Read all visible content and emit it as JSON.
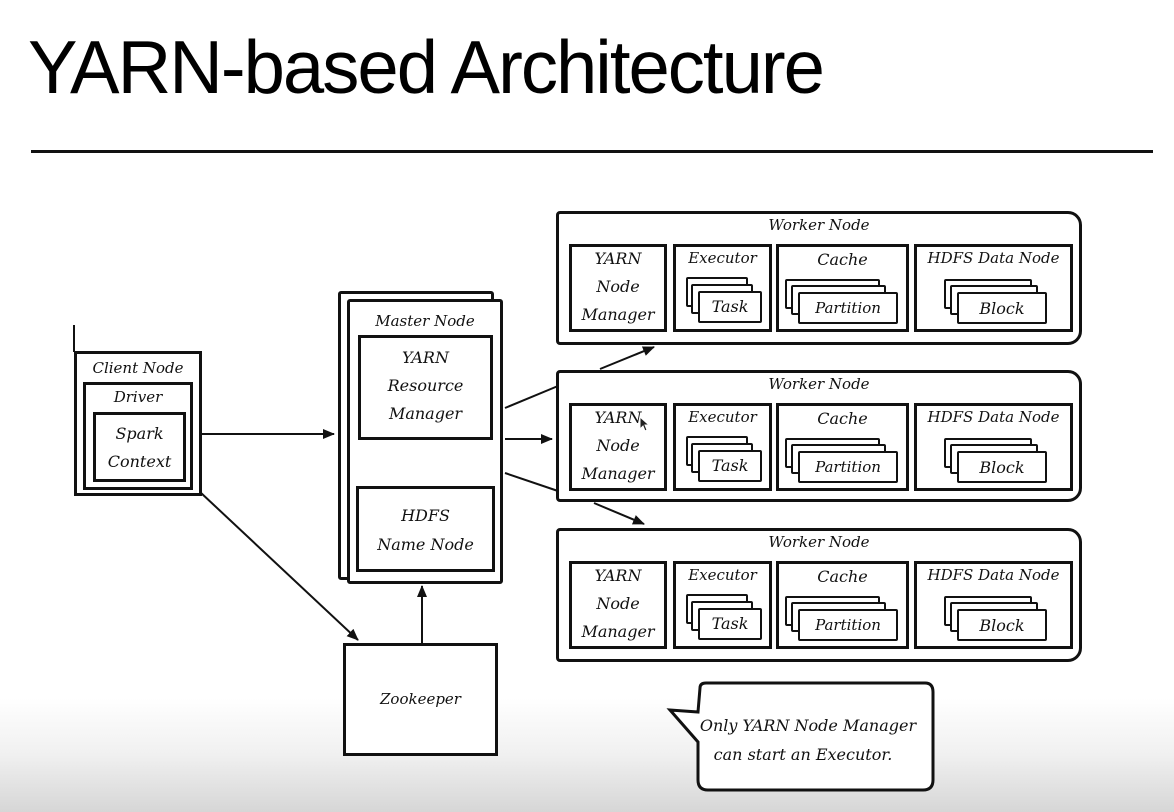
{
  "slide": {
    "title": "YARN-based Architecture"
  },
  "client_node": {
    "title": "Client Node",
    "driver_label": "Driver",
    "spark_context_line1": "Spark",
    "spark_context_line2": "Context"
  },
  "master_node": {
    "title": "Master Node",
    "resource_manager_line1": "YARN",
    "resource_manager_line2": "Resource",
    "resource_manager_line3": "Manager",
    "name_node_line1": "HDFS",
    "name_node_line2": "Name Node"
  },
  "zookeeper": {
    "label": "Zookeeper"
  },
  "worker_nodes": [
    {
      "title": "Worker Node",
      "node_manager_line1": "YARN",
      "node_manager_line2": "Node",
      "node_manager_line3": "Manager",
      "executor_label": "Executor",
      "task_label": "Task",
      "cache_label": "Cache",
      "partition_label": "Partition",
      "data_node_label": "HDFS Data Node",
      "block_label": "Block"
    },
    {
      "title": "Worker Node",
      "node_manager_line1": "YARN",
      "node_manager_line2": "Node",
      "node_manager_line3": "Manager",
      "executor_label": "Executor",
      "task_label": "Task",
      "cache_label": "Cache",
      "partition_label": "Partition",
      "data_node_label": "HDFS Data Node",
      "block_label": "Block"
    },
    {
      "title": "Worker Node",
      "node_manager_line1": "YARN",
      "node_manager_line2": "Node",
      "node_manager_line3": "Manager",
      "executor_label": "Executor",
      "task_label": "Task",
      "cache_label": "Cache",
      "partition_label": "Partition",
      "data_node_label": "HDFS Data Node",
      "block_label": "Block"
    }
  ],
  "callout": {
    "line1": "Only YARN Node Manager",
    "line2": "can start an Executor."
  },
  "connections": [
    {
      "from": "Spark Context",
      "to": "Master Node"
    },
    {
      "from": "Client Node",
      "to": "Zookeeper"
    },
    {
      "from": "Zookeeper",
      "to": "Master Node"
    },
    {
      "from": "YARN Resource Manager",
      "to": "HDFS Name Node"
    },
    {
      "from": "Master Node",
      "to": "Worker Node 1"
    },
    {
      "from": "Master Node",
      "to": "Worker Node 2"
    },
    {
      "from": "Master Node",
      "to": "Worker Node 3"
    }
  ],
  "cursor_icon": "mouse-pointer-icon"
}
